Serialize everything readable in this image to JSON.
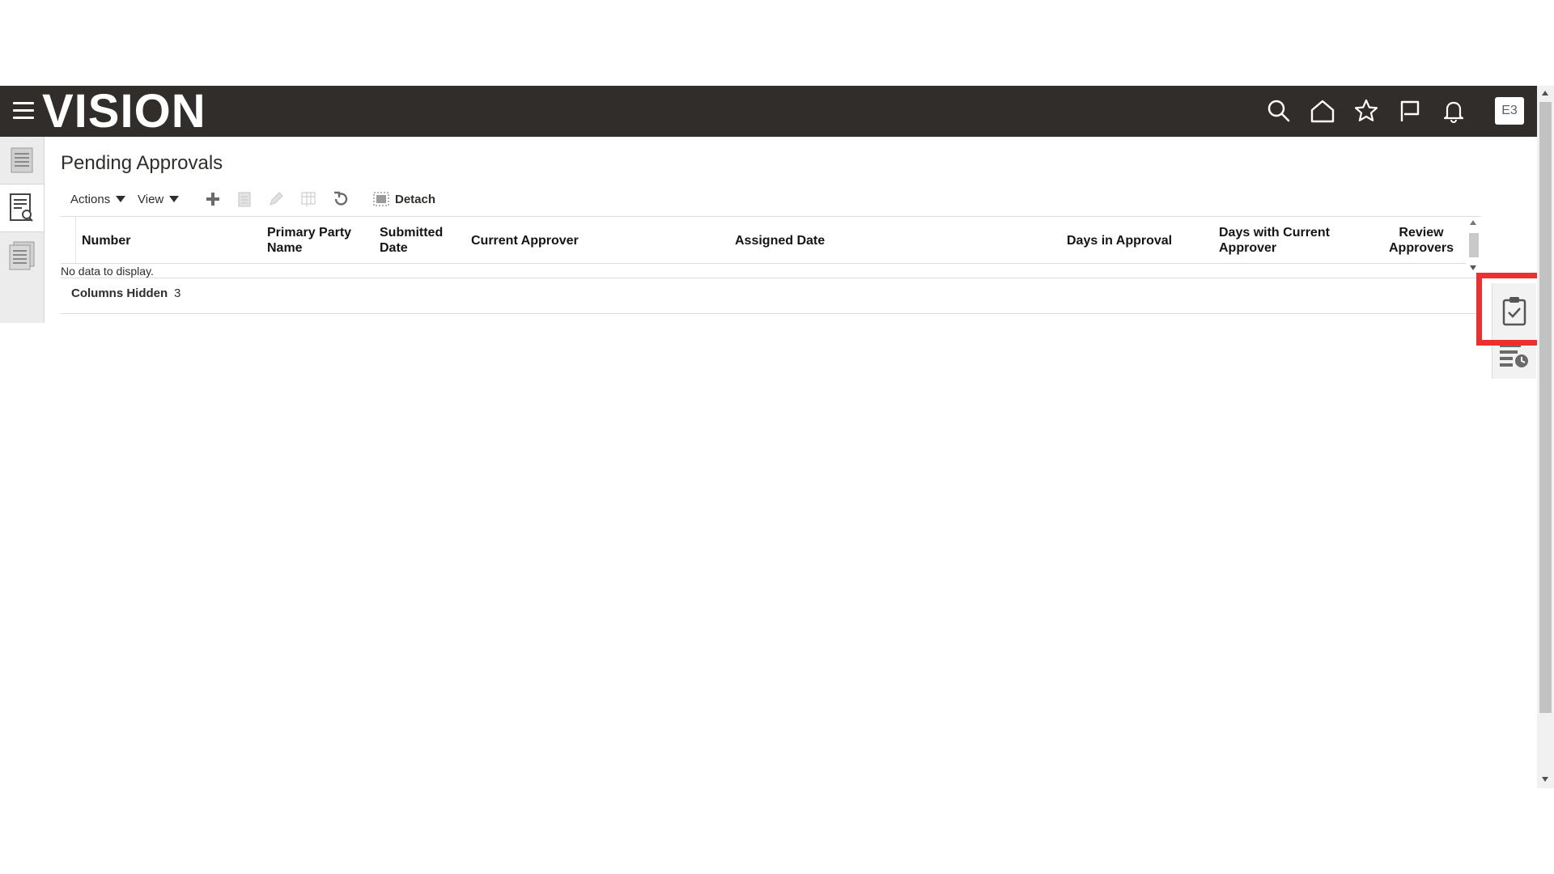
{
  "header": {
    "logo_text": "VISION",
    "avatar_initials": "E3",
    "icons": [
      "menu-icon",
      "search-icon",
      "home-icon",
      "star-icon",
      "flag-icon",
      "bell-icon"
    ]
  },
  "left_rail": {
    "tabs": [
      "list-icon",
      "document-search-icon",
      "documents-icon"
    ]
  },
  "page": {
    "title": "Pending Approvals"
  },
  "toolbar": {
    "actions_label": "Actions",
    "view_label": "View",
    "detach_label": "Detach",
    "icons": [
      "add-icon",
      "duplicate-icon",
      "edit-icon",
      "freeze-icon",
      "refresh-icon",
      "detach-icon"
    ]
  },
  "table": {
    "columns": [
      {
        "label": "Number"
      },
      {
        "label": "Primary Party Name"
      },
      {
        "label": "Submitted Date"
      },
      {
        "label": "Current Approver"
      },
      {
        "label": "Assigned Date"
      },
      {
        "label": "Days in Approval"
      },
      {
        "label": "Days with Current Approver"
      },
      {
        "label": "Review Approvers"
      }
    ],
    "empty_message": "No data to display.",
    "columns_hidden_label": "Columns Hidden",
    "columns_hidden_count": "3"
  },
  "right_rail": {
    "tabs": [
      "clipboard-check-icon",
      "task-clock-icon"
    ]
  },
  "colors": {
    "header_bg": "#312d2a",
    "highlight_border": "#ec2f2f"
  }
}
